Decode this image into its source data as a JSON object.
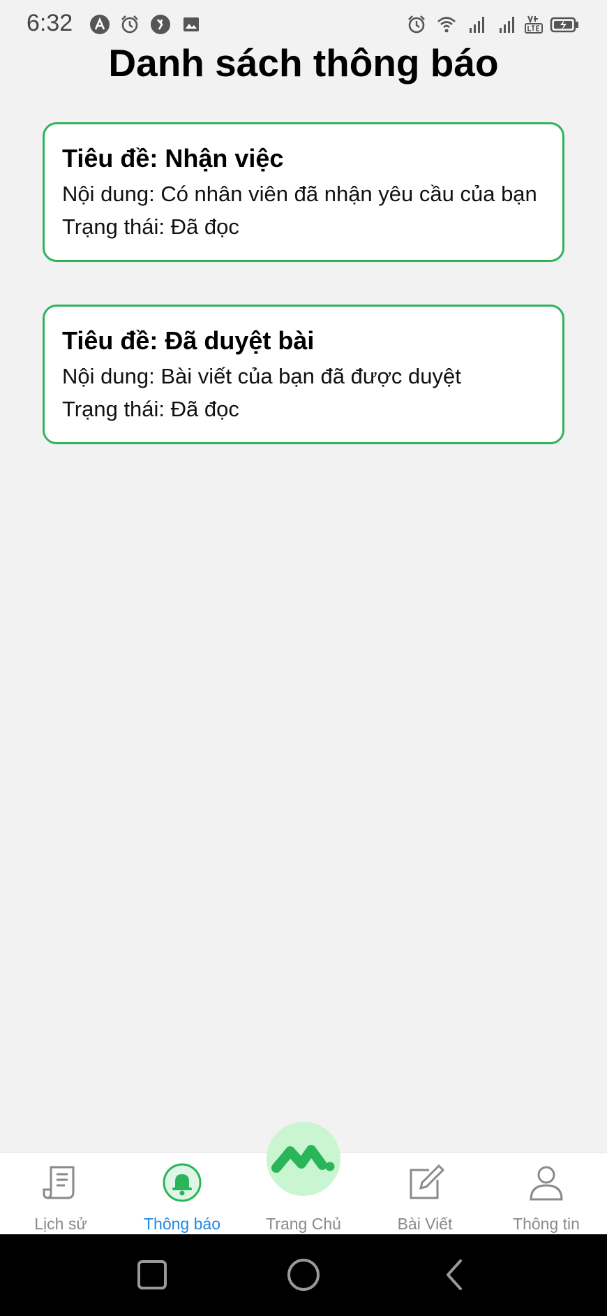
{
  "status_bar": {
    "time": "6:32",
    "icons_left": [
      "app-a-icon",
      "alarm-icon",
      "vpn-icon",
      "image-icon"
    ],
    "icons_right": [
      "alarm-icon",
      "wifi-icon",
      "signal-icon",
      "signal-icon",
      "volte-icon",
      "battery-charging-icon"
    ]
  },
  "page": {
    "title": "Danh sách thông báo"
  },
  "notifications": [
    {
      "title": "Tiêu đề: Nhận việc",
      "content": "Nội dung: Có nhân viên đã nhận yêu cầu của bạn",
      "status": "Trạng thái:  Đã đọc"
    },
    {
      "title": "Tiêu đề: Đã duyệt bài",
      "content": "Nội dung: Bài viết của bạn đã được duyệt",
      "status": "Trạng thái:  Đã đọc"
    }
  ],
  "bottom_nav": {
    "items": [
      {
        "label": "Lịch sử",
        "icon": "history-icon",
        "active": false
      },
      {
        "label": "Thông báo",
        "icon": "bell-icon",
        "active": true
      },
      {
        "label": "Trang Chủ",
        "icon": "home-logo-icon",
        "active": false
      },
      {
        "label": "Bài Viết",
        "icon": "edit-icon",
        "active": false
      },
      {
        "label": "Thông tin",
        "icon": "user-icon",
        "active": false
      }
    ]
  },
  "colors": {
    "accent_green": "#2bb55b",
    "active_blue": "#1e88e5",
    "fab_bg": "#c9f5d0"
  }
}
